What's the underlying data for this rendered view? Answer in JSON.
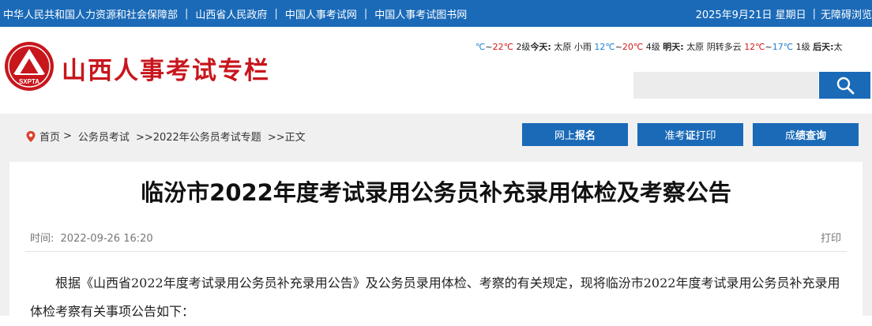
{
  "topbar": {
    "links": [
      "中华人民共和国人力资源和社会保障部",
      "山西省人民政府",
      "中国人事考试网",
      "中国人事考试图书网"
    ],
    "separator": "|",
    "date": "2025年9月21日 星期日",
    "accessibility": "无障碍浏览"
  },
  "header": {
    "site_title": "山西人事考试专栏",
    "logo_text": "SXPTA",
    "weather": {
      "today_tail_low": "℃",
      "today_tail_high": "22℃",
      "today_tail_wind": "2级",
      "today_label": "今天:",
      "today_city": "太原",
      "today_weather": "小雨",
      "today_low": "12℃",
      "today_high": "20℃",
      "today_wind": "4级",
      "tomorrow_label": "明天:",
      "tomorrow_city": "太原",
      "tomorrow_weather": "阴转多云",
      "tomorrow_low": "12℃",
      "tomorrow_high": "17℃",
      "tomorrow_wind": "1级",
      "after_label": "后天:",
      "after_city": "太",
      "tilde": "~"
    },
    "search_placeholder": ""
  },
  "breadcrumb": {
    "home": "首页",
    "sep1": ">",
    "item1": "公务员考试",
    "item2": ">>2022年公务员考试专题",
    "item3": ">>正文"
  },
  "nav_buttons": [
    {
      "pre": "网上",
      "bold": "报名",
      "post": ""
    },
    {
      "pre": "准考",
      "bold": "证",
      "post": "打印"
    },
    {
      "pre": "成",
      "bold": "绩查询",
      "post": ""
    }
  ],
  "article": {
    "title": "临汾市2022年度考试录用公务员补充录用体检及考察公告",
    "time_label": "时间:",
    "time_value": "2022-09-26 16:20",
    "print_label": "打印",
    "body": "根据《山西省2022年度考试录用公务员补充录用公告》及公务员录用体检、考察的有关规定，现将临汾市2022年度考试录用公务员补充录用体检考察有关事项公告如下："
  },
  "colors": {
    "brand_blue": "#1a6ab8",
    "brand_red": "#c8161d"
  },
  "icons": [
    "logo-emblem-icon",
    "search-icon",
    "location-pin-icon"
  ]
}
